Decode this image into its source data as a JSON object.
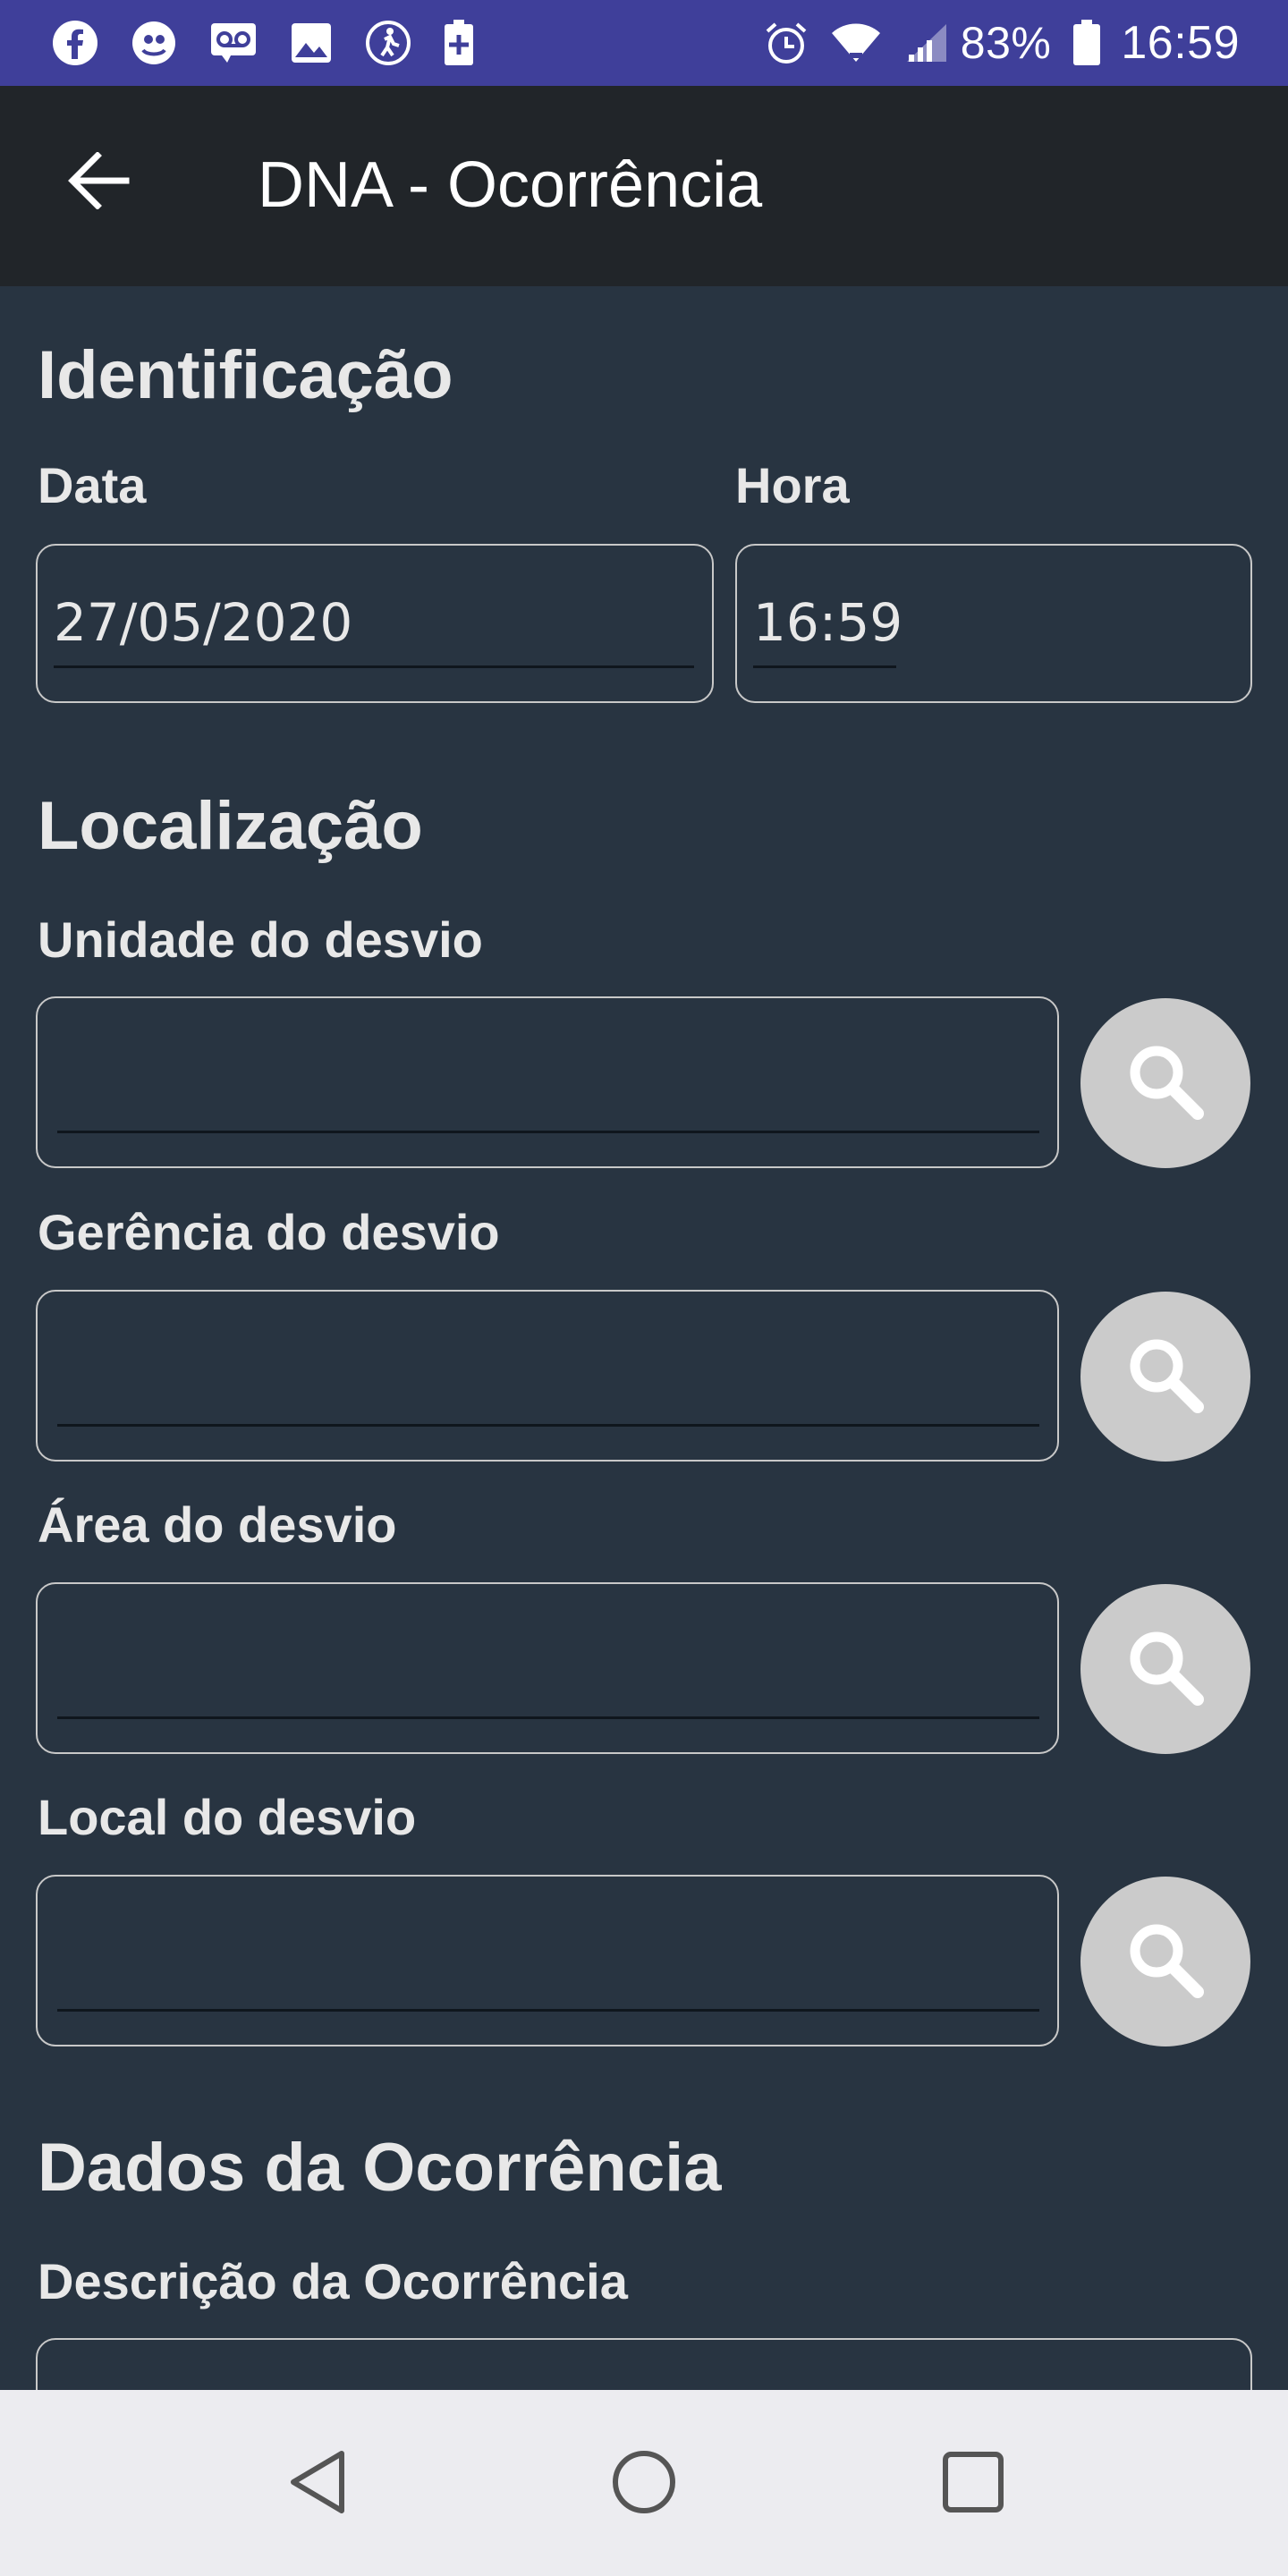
{
  "status_bar": {
    "icons_left": [
      "facebook-icon",
      "bug-icon",
      "voicemail-icon",
      "image-icon",
      "accessibility-icon",
      "battery-plus-icon"
    ],
    "icons_right": [
      "alarm-icon",
      "wifi-icon",
      "signal-icon",
      "battery-icon"
    ],
    "battery": "83%",
    "time": "16:59",
    "color": "#3f3f9a"
  },
  "app_bar": {
    "title": "DNA - Ocorrência",
    "back_icon": "arrow-back-icon",
    "color": "#212529"
  },
  "identificacao": {
    "title": "Identificação",
    "date_label": "Data",
    "date_value": "27/05/2020",
    "time_label": "Hora",
    "time_value": "16:59"
  },
  "localizacao": {
    "title": "Localização",
    "fields": [
      {
        "label": "Unidade do desvio",
        "value": ""
      },
      {
        "label": "Gerência do desvio",
        "value": ""
      },
      {
        "label": "Área do desvio",
        "value": ""
      },
      {
        "label": "Local do desvio",
        "value": ""
      }
    ],
    "search_icon": "search-icon"
  },
  "dados_ocorrencia": {
    "title": "Dados da Ocorrência",
    "description_label": "Descrição da Ocorrência"
  },
  "nav_bar": {
    "buttons": [
      "back-triangle-icon",
      "home-circle-icon",
      "recents-square-icon"
    ]
  },
  "colors": {
    "background": "#283441",
    "search_button": "#cbcbcb"
  }
}
